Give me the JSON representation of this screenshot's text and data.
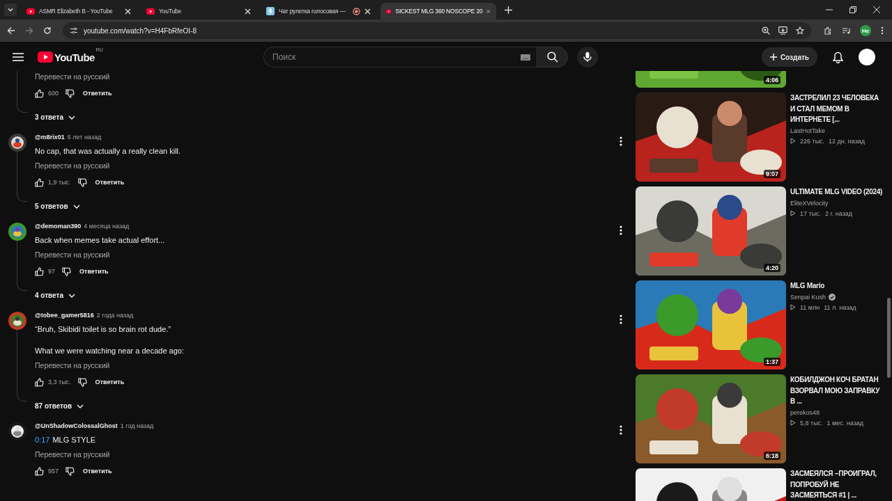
{
  "browser": {
    "tabs": [
      {
        "title": "ASMR Elizabeth B - YouTube",
        "kind": "youtube",
        "recording": false,
        "selected": false
      },
      {
        "title": "YouTube",
        "kind": "youtube",
        "recording": false,
        "selected": false
      },
      {
        "title": "Чат рулетка голосовая — ",
        "kind": "voice",
        "recording": true,
        "selected": false
      },
      {
        "title": "SICKEST MLG 360 NOSCOPE 20",
        "kind": "youtube",
        "recording": false,
        "selected": true
      }
    ],
    "url": "youtube.com/watch?v=H4FbRfeOI-8",
    "profile": "He"
  },
  "header": {
    "logo": "YouTube",
    "region": "RU",
    "search_placeholder": "Поиск",
    "create": "Создать"
  },
  "comments": [
    {
      "kind": "partial",
      "translate": "Перевести на русский",
      "likes": "600",
      "reply": "Ответить",
      "replies": "3 ответа"
    },
    {
      "kind": "full",
      "author": "@m8rix01",
      "age": "6 лет назад",
      "paragraphs": [
        "No cap, that was actually a really clean kill."
      ],
      "translate": "Перевести на русский",
      "likes": "1,9 тыс.",
      "reply": "Ответить",
      "replies": "5 ответов"
    },
    {
      "kind": "full",
      "author": "@demoman390",
      "age": "4 месяца назад",
      "paragraphs": [
        "Back when memes take actual effort..."
      ],
      "translate": "Перевести на русский",
      "likes": "97",
      "reply": "Ответить",
      "replies": "4 ответа"
    },
    {
      "kind": "full",
      "author": "@tobee_gamer5816",
      "age": "2 года назад",
      "paragraphs": [
        "“Bruh, Skibidi toilet is so brain rot dude.”",
        "What we were watching near a decade ago:"
      ],
      "translate": "Перевести на русский",
      "likes": "3,3 тыс.",
      "reply": "Ответить",
      "replies": "87 ответов"
    },
    {
      "kind": "full",
      "author": "@UnShadowColossalGhost",
      "age": "1 год назад",
      "timestamp": "0:17",
      "paragraphs": [
        "MLG STYLE"
      ],
      "translate": "Перевести на русский",
      "likes": "957",
      "reply": "Ответить"
    }
  ],
  "videos": [
    {
      "duration": "4:06"
    },
    {
      "title": "ЗАСТРЕЛИЛ 23 ЧЕЛОВЕКА И СТАЛ МЕМОМ В ИНТЕРНЕТЕ [...",
      "channel": "LastHotTake",
      "verified": false,
      "views": "226 тыс.",
      "age": "12 дн. назад",
      "duration": "9:07"
    },
    {
      "title": "ULTIMATE MLG VIDEO (2024)",
      "channel": "EliteXVelocity",
      "verified": false,
      "views": "17 тыс.",
      "age": "2 г. назад",
      "duration": "4:20"
    },
    {
      "title": "MLG Mario",
      "channel": "Senpai Kush",
      "verified": true,
      "views": "11 млн",
      "age": "11 л. назад",
      "duration": "1:37"
    },
    {
      "title": "КОБИЛДЖОН КОЧ БРАТАН ВЗОРВАЛ МОЮ ЗАПРАВКУ В ...",
      "channel": "perekos48",
      "verified": false,
      "views": "5,8 тыс.",
      "age": "1 мес. назад",
      "duration": "6:18"
    },
    {
      "title": "ЗАСМЕЯЛСЯ −ПРОИГРАЛ, ПОПРОБУЙ НЕ ЗАСМЕЯТЬСЯ #1 | ..."
    }
  ]
}
